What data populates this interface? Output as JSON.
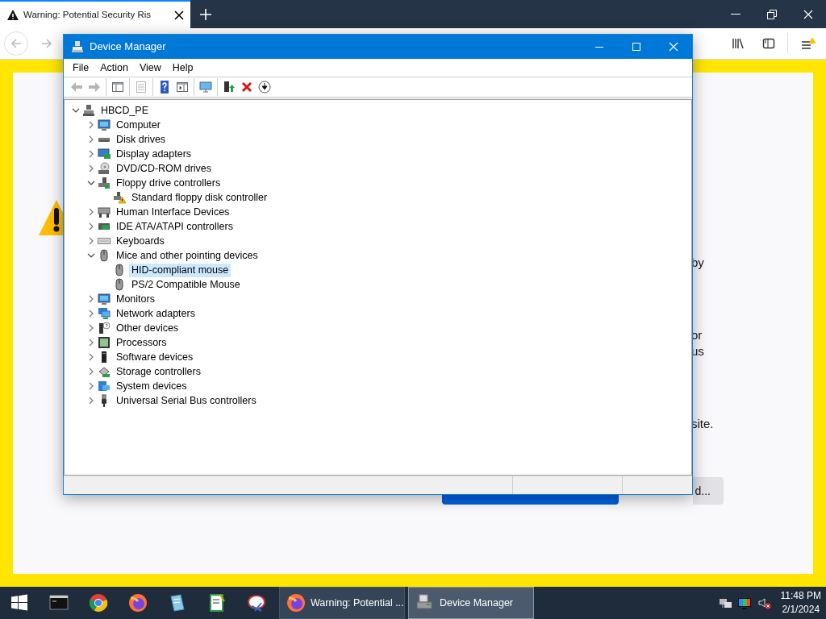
{
  "browser": {
    "tabs": [
      {
        "title": "Warning: Potential Security Ris",
        "selected": true
      }
    ],
    "page": {
      "paragraphs": [
        [
          "by"
        ],
        [
          "or",
          "us"
        ],
        [
          "site."
        ]
      ],
      "buttons": [
        {
          "kind": "primary"
        },
        {
          "kind": "secondary",
          "label": "d..."
        }
      ]
    }
  },
  "device_manager": {
    "title": "Device Manager",
    "menu": [
      "File",
      "Action",
      "View",
      "Help"
    ],
    "toolbar": [
      [
        {
          "disabled": true
        },
        {
          "disabled": true
        }
      ],
      [
        {
          "disabled": false
        }
      ],
      [
        {
          "disabled": true
        }
      ],
      [
        {
          "disabled": false
        },
        {
          "disabled": false
        }
      ],
      [
        {
          "disabled": false
        }
      ],
      [
        {
          "disabled": false
        },
        {
          "disabled": false
        },
        {
          "disabled": false
        }
      ]
    ],
    "tree": {
      "label": "HBCD_PE",
      "expanded": true,
      "selected": false,
      "children": [
        {
          "label": "Computer",
          "expanded": false,
          "selected": false
        },
        {
          "label": "Disk drives",
          "expanded": false,
          "selected": false
        },
        {
          "label": "Display adapters",
          "expanded": false,
          "selected": false
        },
        {
          "label": "DVD/CD-ROM drives",
          "expanded": false,
          "selected": false
        },
        {
          "label": "Floppy drive controllers",
          "expanded": true,
          "selected": false,
          "children": [
            {
              "label": "Standard floppy disk controller",
              "selected": false
            }
          ]
        },
        {
          "label": "Human Interface Devices",
          "expanded": false,
          "selected": false
        },
        {
          "label": "IDE ATA/ATAPI controllers",
          "expanded": false,
          "selected": false
        },
        {
          "label": "Keyboards",
          "expanded": false,
          "selected": false
        },
        {
          "label": "Mice and other pointing devices",
          "expanded": true,
          "selected": false,
          "children": [
            {
              "label": "HID-compliant mouse",
              "selected": true
            },
            {
              "label": "PS/2 Compatible Mouse",
              "selected": false
            }
          ]
        },
        {
          "label": "Monitors",
          "expanded": false,
          "selected": false
        },
        {
          "label": "Network adapters",
          "expanded": false,
          "selected": false
        },
        {
          "label": "Other devices",
          "expanded": false,
          "selected": false
        },
        {
          "label": "Processors",
          "expanded": false,
          "selected": false
        },
        {
          "label": "Software devices",
          "expanded": false,
          "selected": false
        },
        {
          "label": "Storage controllers",
          "expanded": false,
          "selected": false
        },
        {
          "label": "System devices",
          "expanded": false,
          "selected": false
        },
        {
          "label": "Universal Serial Bus controllers",
          "expanded": false,
          "selected": false
        }
      ]
    }
  },
  "taskbar": {
    "windows": [
      {
        "label": "Warning: Potential ...",
        "selected": false
      },
      {
        "label": "Device Manager",
        "selected": true
      }
    ],
    "clock": {
      "time": "11:48 PM",
      "date": "2/1/2024"
    }
  }
}
